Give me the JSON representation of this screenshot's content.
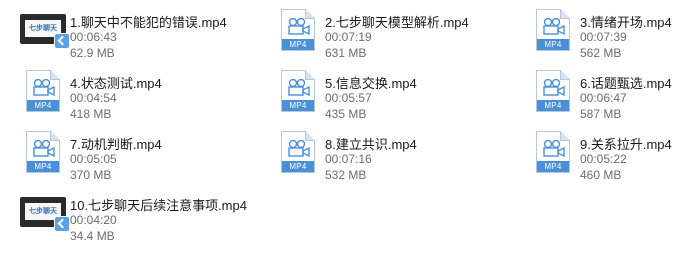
{
  "files": [
    {
      "name": "1.聊天中不能犯的错误.mp4",
      "duration": "00:06:43",
      "size": "62.9 MB",
      "icon": "video-thumbnail-icon",
      "thumb_text": "七步聊天"
    },
    {
      "name": "2.七步聊天模型解析.mp4",
      "duration": "00:07:19",
      "size": "631 MB",
      "icon": "mp4-file-icon",
      "badge": "MP4"
    },
    {
      "name": "3.情绪开场.mp4",
      "duration": "00:07:39",
      "size": "562 MB",
      "icon": "mp4-file-icon",
      "badge": "MP4"
    },
    {
      "name": "4.状态测试.mp4",
      "duration": "00:04:54",
      "size": "418 MB",
      "icon": "mp4-file-icon",
      "badge": "MP4"
    },
    {
      "name": "5.信息交换.mp4",
      "duration": "00:05:57",
      "size": "435 MB",
      "icon": "mp4-file-icon",
      "badge": "MP4"
    },
    {
      "name": "6.话题甄选.mp4",
      "duration": "00:06:47",
      "size": "587 MB",
      "icon": "mp4-file-icon",
      "badge": "MP4"
    },
    {
      "name": "7.动机判断.mp4",
      "duration": "00:05:05",
      "size": "370 MB",
      "icon": "mp4-file-icon",
      "badge": "MP4"
    },
    {
      "name": "8.建立共识.mp4",
      "duration": "00:07:16",
      "size": "532 MB",
      "icon": "mp4-file-icon",
      "badge": "MP4"
    },
    {
      "name": "9.关系拉升.mp4",
      "duration": "00:05:22",
      "size": "460 MB",
      "icon": "mp4-file-icon",
      "badge": "MP4"
    },
    {
      "name": "10.七步聊天后续注意事项.mp4",
      "duration": "00:04:20",
      "size": "34.4 MB",
      "icon": "video-thumbnail-icon",
      "thumb_text": "七步聊天"
    }
  ],
  "colors": {
    "badge": "#4a90d9",
    "name": "#1a1a1a",
    "meta": "#6d6d6d"
  }
}
